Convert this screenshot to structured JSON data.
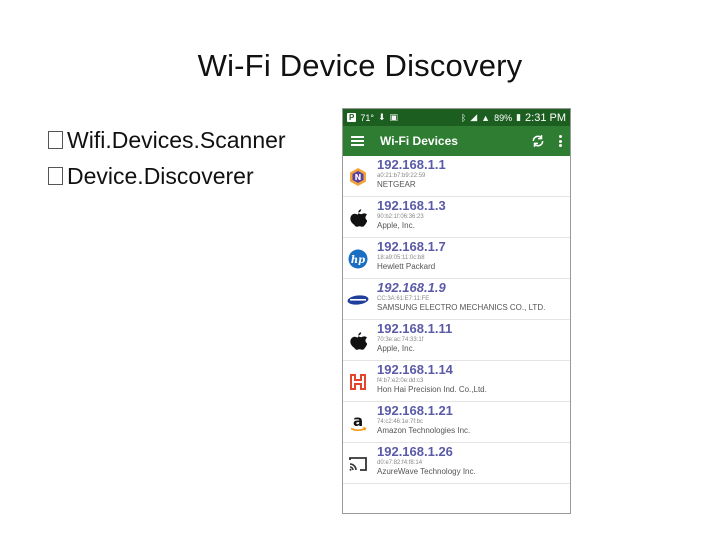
{
  "slide": {
    "title": "Wi-Fi Device Discovery",
    "bullets": [
      {
        "box": "",
        "text": "Wifi.Devices.Scanner"
      },
      {
        "box": "",
        "text": "Device.Discoverer"
      }
    ]
  },
  "status_bar": {
    "notification": "P",
    "temperature": "71°",
    "battery": "89%",
    "time": "2:31 PM"
  },
  "app_bar": {
    "title": "Wi-Fi Devices"
  },
  "devices": [
    {
      "icon": "netgear-logo-icon",
      "ip": "192.168.1.1",
      "mac": "a0:21:b7:b9:22:59",
      "vendor": "NETGEAR"
    },
    {
      "icon": "apple-logo-icon",
      "ip": "192.168.1.3",
      "mac": "90:b2:1f:06:36:23",
      "vendor": "Apple, Inc."
    },
    {
      "icon": "hp-logo-icon",
      "ip": "192.168.1.7",
      "mac": "18:a9:05:11:0c:b8",
      "vendor": "Hewlett Packard"
    },
    {
      "icon": "samsung-logo-icon",
      "ip": "192.168.1.9",
      "mac": "CC:3A:61:E7:11:FE",
      "vendor": "SAMSUNG ELECTRO MECHANICS CO., LTD."
    },
    {
      "icon": "apple-logo-icon",
      "ip": "192.168.1.11",
      "mac": "70:3e:ac:74:33:1f",
      "vendor": "Apple, Inc."
    },
    {
      "icon": "foxconn-logo-icon",
      "ip": "192.168.1.14",
      "mac": "f4:b7:e2:0e:dd:c3",
      "vendor": "Hon Hai Precision Ind. Co.,Ltd."
    },
    {
      "icon": "amazon-logo-icon",
      "ip": "192.168.1.21",
      "mac": "74:c2:46:1e:7f:bc",
      "vendor": "Amazon Technologies Inc."
    },
    {
      "icon": "cast-screen-icon",
      "ip": "192.168.1.26",
      "mac": "d0:e7:82:f4:f8:14",
      "vendor": "AzureWave Technology Inc."
    }
  ],
  "colors": {
    "status_bar": "#1b5e20",
    "app_bar": "#2e7d32",
    "ip_text": "#5a5aa8"
  }
}
